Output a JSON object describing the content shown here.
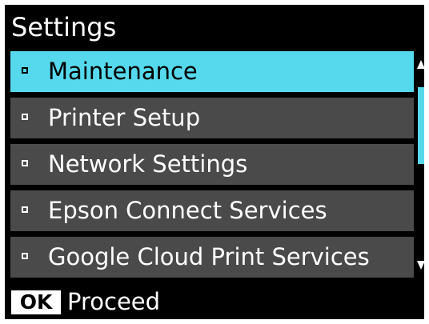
{
  "header": {
    "title": "Settings"
  },
  "menu": {
    "items": [
      {
        "label": "Maintenance",
        "selected": true
      },
      {
        "label": "Printer Setup",
        "selected": false
      },
      {
        "label": "Network Settings",
        "selected": false
      },
      {
        "label": "Epson Connect Services",
        "selected": false
      },
      {
        "label": "Google Cloud Print Services",
        "selected": false
      }
    ]
  },
  "scrollbar": {
    "up_icon": "arrow-up-icon",
    "down_icon": "arrow-down-icon"
  },
  "footer": {
    "ok_label": "OK",
    "action_label": "Proceed"
  },
  "colors": {
    "highlight": "#56d9ec",
    "item_background": "#4a4a4a",
    "screen_background": "#000000",
    "text": "#ffffff"
  }
}
